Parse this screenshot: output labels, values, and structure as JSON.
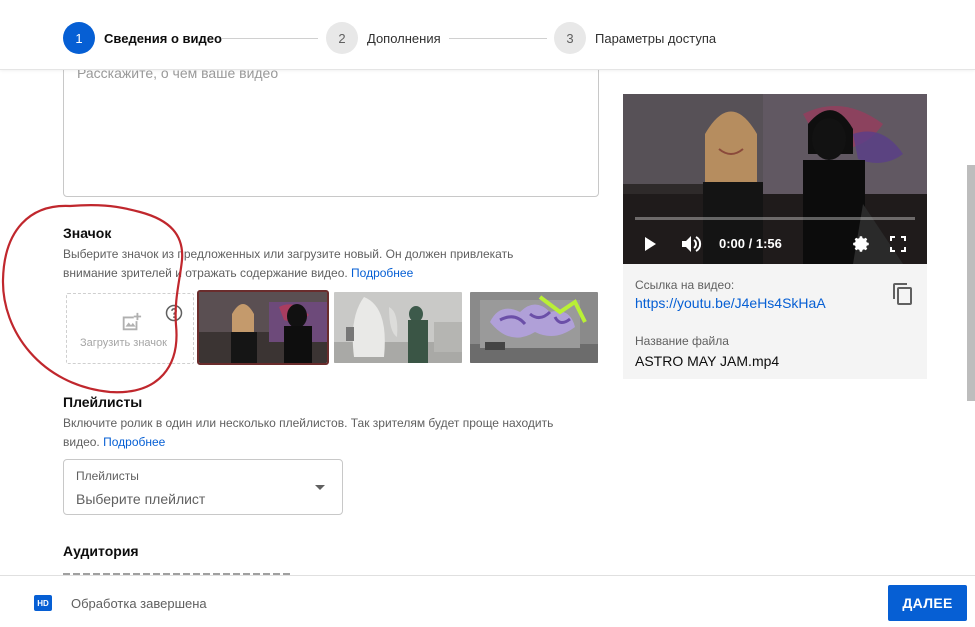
{
  "stepper": {
    "steps": [
      {
        "number": "1",
        "label": "Сведения о видео",
        "active": true
      },
      {
        "number": "2",
        "label": "Дополнения",
        "active": false
      },
      {
        "number": "3",
        "label": "Параметры доступа",
        "active": false
      }
    ]
  },
  "description": {
    "placeholder": "Расскажите, о чем ваше видео"
  },
  "thumbnail": {
    "title": "Значок",
    "help_text": "Выберите значок из предложенных или загрузите новый. Он должен привлекать внимание зрителей и отражать содержание видео.",
    "more_link": "Подробнее",
    "upload_label": "Загрузить значок",
    "upload_icon": "add-photo-icon",
    "help_icon": "help-circle-icon"
  },
  "playlists": {
    "title": "Плейлисты",
    "help_text": "Включите ролик в один или несколько плейлистов. Так зрителям будет проще находить видео.",
    "more_link": "Подробнее",
    "select_label": "Плейлисты",
    "select_value": "Выберите плейлист"
  },
  "audience": {
    "title": "Аудитория"
  },
  "video": {
    "time": "0:00 / 1:56",
    "progress": 0,
    "link_label": "Ссылка на видео:",
    "link": "https://youtu.be/J4eHs4SkHaA",
    "filename_label": "Название файла",
    "filename": "ASTRO MAY JAM.mp4"
  },
  "footer": {
    "badge": "HD",
    "status": "Обработка завершена",
    "next_button": "ДАЛЕЕ"
  },
  "colors": {
    "accent": "#065fd4",
    "annotation": "#c0272d"
  }
}
